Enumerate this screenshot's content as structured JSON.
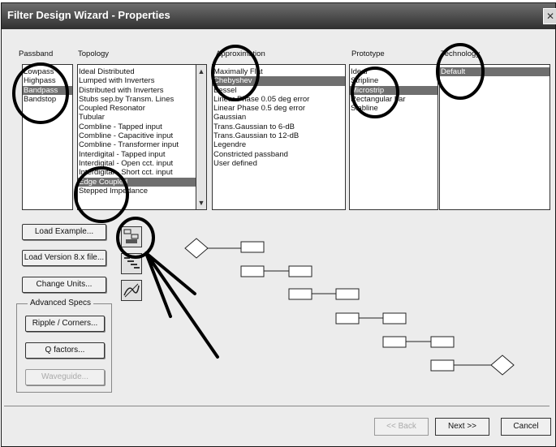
{
  "window": {
    "title": "Filter Design Wizard - Properties",
    "close_glyph": "✕"
  },
  "columns": {
    "passband": "Passband",
    "topology": "Topology",
    "approximation": "Approximation",
    "prototype": "Prototype",
    "technology": "Technology"
  },
  "passband_items": [
    {
      "label": "Lowpass",
      "selected": false
    },
    {
      "label": "Highpass",
      "selected": false
    },
    {
      "label": "Bandpass",
      "selected": true
    },
    {
      "label": "Bandstop",
      "selected": false
    }
  ],
  "topology_items": [
    {
      "label": "Ideal Distributed",
      "selected": false
    },
    {
      "label": "Lumped with Inverters",
      "selected": false
    },
    {
      "label": "Distributed with Inverters",
      "selected": false
    },
    {
      "label": "Stubs sep.by Transm. Lines",
      "selected": false
    },
    {
      "label": "Coupled Resonator",
      "selected": false
    },
    {
      "label": "Tubular",
      "selected": false
    },
    {
      "label": "Combline - Tapped input",
      "selected": false
    },
    {
      "label": "Combline - Capacitive input",
      "selected": false
    },
    {
      "label": "Combline - Transformer input",
      "selected": false
    },
    {
      "label": "Interdigital - Tapped input",
      "selected": false
    },
    {
      "label": "Interdigital - Open cct. input",
      "selected": false
    },
    {
      "label": "Interdigital - Short cct. input",
      "selected": false
    },
    {
      "label": "Edge Coupled",
      "selected": true
    },
    {
      "label": "Stepped Impedance",
      "selected": false
    }
  ],
  "approximation_items": [
    {
      "label": "Maximally Flat",
      "selected": false
    },
    {
      "label": "Chebyshev",
      "selected": true
    },
    {
      "label": "Bessel",
      "selected": false
    },
    {
      "label": "Linear Phase 0.05 deg error",
      "selected": false
    },
    {
      "label": "Linear Phase 0.5 deg error",
      "selected": false
    },
    {
      "label": "Gaussian",
      "selected": false
    },
    {
      "label": "Trans.Gaussian to 6-dB",
      "selected": false
    },
    {
      "label": "Trans.Gaussian to 12-dB",
      "selected": false
    },
    {
      "label": "Legendre",
      "selected": false
    },
    {
      "label": "Constricted passband",
      "selected": false
    },
    {
      "label": "User defined",
      "selected": false
    }
  ],
  "prototype_items": [
    {
      "label": "Ideal",
      "selected": false
    },
    {
      "label": "Stripline",
      "selected": false
    },
    {
      "label": "Microstrip",
      "selected": true
    },
    {
      "label": "Rectangular bar",
      "selected": false
    },
    {
      "label": "Slabline",
      "selected": false
    }
  ],
  "technology_items": [
    {
      "label": "Default",
      "selected": true
    }
  ],
  "buttons": {
    "load_example": "Load Example...",
    "load_version": "Load Version 8.x file...",
    "change_units": "Change Units...",
    "advanced_specs": "Advanced Specs",
    "ripple_corners": "Ripple / Corners...",
    "q_factors": "Q factors...",
    "waveguide": "Waveguide..."
  },
  "nav": {
    "back": "<< Back",
    "next": "Next >>",
    "cancel": "Cancel"
  },
  "colors": {
    "selection": "#6f6f6f",
    "annotation": "#000000"
  }
}
